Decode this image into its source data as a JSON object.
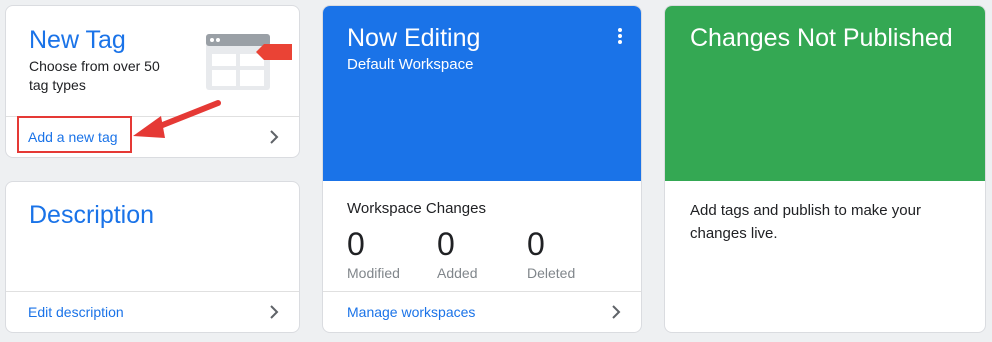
{
  "new_tag": {
    "title": "New Tag",
    "description": "Choose from over 50 tag types",
    "link": "Add a new tag",
    "icon": "tag-window-icon"
  },
  "description_card": {
    "title": "Description",
    "link": "Edit description"
  },
  "workspace": {
    "title": "Now Editing",
    "subtitle": "Default Workspace",
    "changes_title": "Workspace Changes",
    "stats": [
      {
        "value": "0",
        "label": "Modified"
      },
      {
        "value": "0",
        "label": "Added"
      },
      {
        "value": "0",
        "label": "Deleted"
      }
    ],
    "link": "Manage workspaces",
    "banner_color": "#1a73e8"
  },
  "publish": {
    "title": "Changes Not Published",
    "text": "Add tags and publish to make your changes live.",
    "banner_color": "#34a853"
  },
  "annotation": {
    "highlight_color": "#e53935"
  }
}
